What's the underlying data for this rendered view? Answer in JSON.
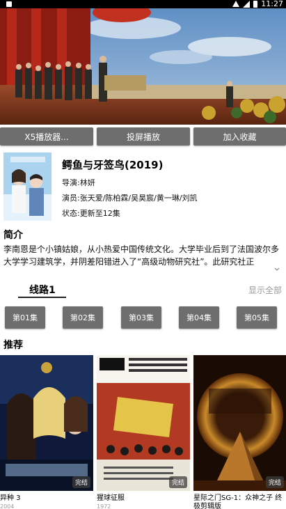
{
  "status_bar": {
    "time": "11:27"
  },
  "actions": [
    {
      "label": "X5播放器..."
    },
    {
      "label": "投屏播放"
    },
    {
      "label": "加入收藏"
    }
  ],
  "movie": {
    "title": "鳄鱼与牙签鸟(2019)",
    "director": "导演:林妍",
    "cast": "演员:张天爱/陈柏霖/吴昊宸/黄一琳/刘凯",
    "status": "状态:更新至12集"
  },
  "intro": {
    "heading": "简介",
    "text": "李南恩是个小镇姑娘，从小热爱中国传统文化。大学毕业后到了法国波尔多大学学习建筑学，并阴差阳错进入了“高级动物研究社”。此研究社正"
  },
  "routes": {
    "tab": "线路1",
    "show_all": "显示全部"
  },
  "episodes": [
    "第01集",
    "第02集",
    "第03集",
    "第04集",
    "第05集"
  ],
  "recommend": {
    "heading": "推荐",
    "items": [
      {
        "name": "异种 3",
        "year": "2004",
        "badge": "完结"
      },
      {
        "name": "猩球征服",
        "year": "1972",
        "badge": "完结"
      },
      {
        "name": "星际之门SG-1：众神之子 终极剪辑版",
        "year": "",
        "badge": "完结"
      }
    ]
  }
}
